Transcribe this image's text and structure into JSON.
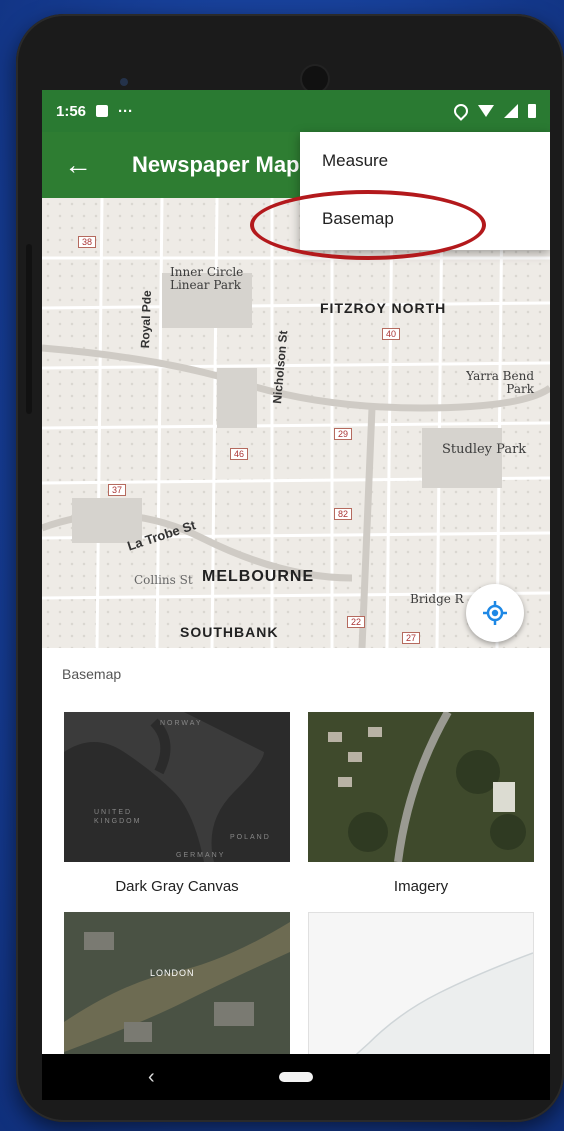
{
  "status_bar": {
    "time": "1:56",
    "dots": "···"
  },
  "app_bar": {
    "back_icon": "arrow-back-icon",
    "title": "Newspaper Map"
  },
  "overflow_menu": {
    "items": [
      {
        "label": "Measure"
      },
      {
        "label": "Basemap"
      }
    ]
  },
  "map": {
    "labels": {
      "inner_circle": "Inner Circle Linear Park",
      "fitzroy_north": "FITZROY NORTH",
      "royal_pde": "Royal Pde",
      "nicholson_st": "Nicholson St",
      "yarra_bend": "Yarra Bend Park",
      "studley_park": "Studley Park",
      "la_trobe": "La Trobe St",
      "collins": "Collins St",
      "melbourne": "MELBOURNE",
      "bridge": "Bridge R",
      "southbank": "SOUTHBANK"
    },
    "shields": [
      "38",
      "46",
      "40",
      "29",
      "37",
      "82",
      "22",
      "27"
    ]
  },
  "basemap_sheet": {
    "title": "Basemap",
    "tiles": [
      {
        "label": "Dark Gray Canvas",
        "map_text": [
          "NORWAY",
          "UNITED KINGDOM",
          "POLAND",
          "GERMANY"
        ]
      },
      {
        "label": "Imagery"
      },
      {
        "label": "",
        "map_text": [
          "LONDON"
        ]
      },
      {
        "label": ""
      }
    ]
  },
  "colors": {
    "primary_green": "#2e7d32",
    "status_green": "#2a7a32",
    "highlight_red": "#b3191c",
    "locate_blue": "#1e88e5"
  }
}
